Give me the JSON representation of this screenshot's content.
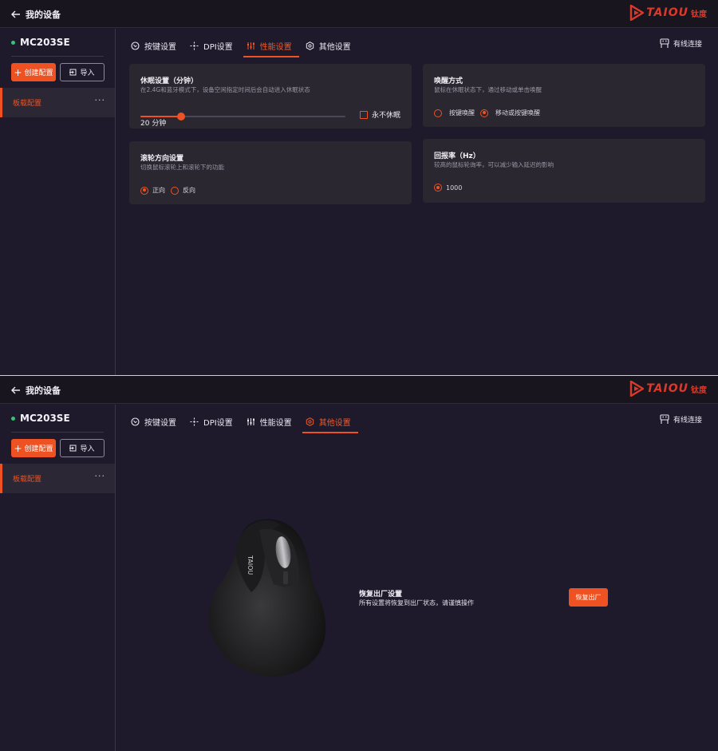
{
  "app": {
    "back_label": "我的设备",
    "brand_name": "TAIOU",
    "brand_cn": "钛度",
    "accent_color": "#ef5222"
  },
  "device": {
    "name": "MC203SE",
    "status": "connected"
  },
  "sidebar": {
    "create_label": "创建配置",
    "import_label": "导入",
    "profile_label": "板载配置",
    "more_label": "···"
  },
  "tabs": [
    {
      "label": "按键设置",
      "icon": "key-settings-icon"
    },
    {
      "label": "DPI设置",
      "icon": "dpi-icon"
    },
    {
      "label": "性能设置",
      "icon": "sliders-icon"
    },
    {
      "label": "其他设置",
      "icon": "gear-icon"
    }
  ],
  "connection_label": "有线连接",
  "performance": {
    "active_tab": "性能设置",
    "sleep": {
      "title": "休眠设置（分钟）",
      "desc": "在2.4G和蓝牙模式下，设备空闲指定时间后会自动进入休眠状态",
      "value_label": "20 分钟",
      "slider_fraction": 0.2,
      "never_sleep_label": "永不休眠",
      "never_sleep_checked": false
    },
    "wake": {
      "title": "唤醒方式",
      "desc": "鼠标在休眠状态下，通过移动或单击唤醒",
      "options": [
        "按键唤醒",
        "移动或按键唤醒"
      ],
      "selected": "移动或按键唤醒"
    },
    "scroll": {
      "title": "滚轮方向设置",
      "desc": "切换鼠标滚轮上和滚轮下的功能",
      "options": [
        "正向",
        "反向"
      ],
      "selected": "正向"
    },
    "polling": {
      "title": "回报率（Hz）",
      "desc": "较高的鼠标轮询率，可以减少输入延迟的影响",
      "options": [
        "1000"
      ],
      "selected": "1000"
    }
  },
  "other": {
    "active_tab": "其他设置",
    "reset_title": "恢复出厂设置",
    "reset_desc": "所有设置将恢复到出厂状态，请谨慎操作",
    "reset_button": "恢复出厂",
    "mouse_logo": "TAIOU"
  }
}
